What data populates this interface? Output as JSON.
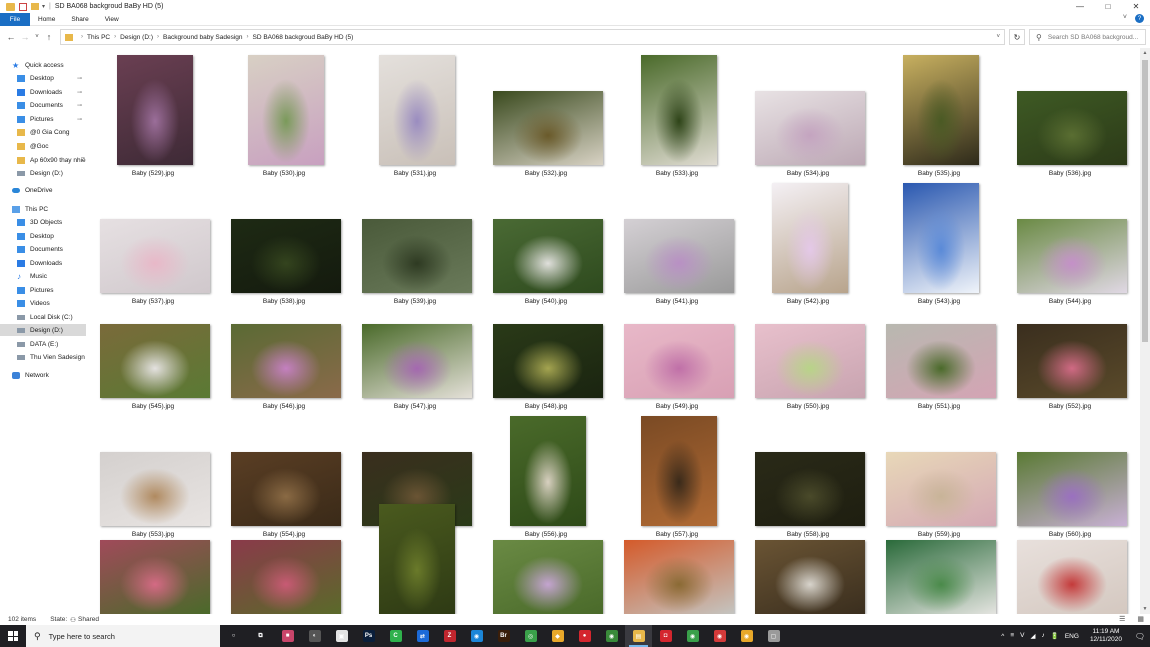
{
  "window": {
    "title": "SD BA068 backgroud BaBy HD (5)",
    "controls": {
      "minimize": "—",
      "maximize": "□",
      "close": "✕"
    }
  },
  "ribbon": {
    "tabs": [
      "File",
      "Home",
      "Share",
      "View"
    ],
    "expand": "˅",
    "help": "?"
  },
  "nav": {
    "back": "←",
    "forward": "→",
    "recent": "˅",
    "up": "↑",
    "breadcrumb": [
      "This PC",
      "Design (D:)",
      "Background baby Sadesign",
      "SD BA068 backgroud BaBy HD (5)"
    ],
    "dropdown": "˅",
    "refresh": "↻",
    "search_placeholder": "Search SD BA068 backgroud..."
  },
  "sidebar": {
    "items": [
      {
        "label": "Quick access",
        "icon": "star-icon",
        "indent": 0,
        "selected": false,
        "pinned": false
      },
      {
        "label": "Desktop",
        "icon": "desktop-icon",
        "indent": 1,
        "selected": false,
        "pinned": true
      },
      {
        "label": "Downloads",
        "icon": "download-icon",
        "indent": 1,
        "selected": false,
        "pinned": true
      },
      {
        "label": "Documents",
        "icon": "documents-icon",
        "indent": 1,
        "selected": false,
        "pinned": true
      },
      {
        "label": "Pictures",
        "icon": "pictures-icon",
        "indent": 1,
        "selected": false,
        "pinned": true
      },
      {
        "label": "@0 Gia Cong",
        "icon": "folder-icon",
        "indent": 1,
        "selected": false,
        "pinned": false
      },
      {
        "label": "@Goc",
        "icon": "folder-icon",
        "indent": 1,
        "selected": false,
        "pinned": false
      },
      {
        "label": "Ap 60x90 thay nhiề",
        "icon": "folder-icon",
        "indent": 1,
        "selected": false,
        "pinned": false
      },
      {
        "label": "Design (D:)",
        "icon": "drive-icon",
        "indent": 1,
        "selected": false,
        "pinned": false
      },
      {
        "label": "OneDrive",
        "icon": "cloud-icon",
        "indent": 0,
        "selected": false,
        "pinned": false
      },
      {
        "label": "This PC",
        "icon": "pc-icon",
        "indent": 0,
        "selected": false,
        "pinned": false
      },
      {
        "label": "3D Objects",
        "icon": "cube-icon",
        "indent": 1,
        "selected": false,
        "pinned": false
      },
      {
        "label": "Desktop",
        "icon": "desktop-icon",
        "indent": 1,
        "selected": false,
        "pinned": false
      },
      {
        "label": "Documents",
        "icon": "documents-icon",
        "indent": 1,
        "selected": false,
        "pinned": false
      },
      {
        "label": "Downloads",
        "icon": "download-icon",
        "indent": 1,
        "selected": false,
        "pinned": false
      },
      {
        "label": "Music",
        "icon": "music-icon",
        "indent": 1,
        "selected": false,
        "pinned": false
      },
      {
        "label": "Pictures",
        "icon": "pictures-icon",
        "indent": 1,
        "selected": false,
        "pinned": false
      },
      {
        "label": "Videos",
        "icon": "videos-icon",
        "indent": 1,
        "selected": false,
        "pinned": false
      },
      {
        "label": "Local Disk (C:)",
        "icon": "drive-icon",
        "indent": 1,
        "selected": false,
        "pinned": false
      },
      {
        "label": "Design (D:)",
        "icon": "drive-icon",
        "indent": 1,
        "selected": true,
        "pinned": false
      },
      {
        "label": "DATA  (E:)",
        "icon": "drive-icon",
        "indent": 1,
        "selected": false,
        "pinned": false
      },
      {
        "label": "Thu Vien Sadesign",
        "icon": "drive-icon",
        "indent": 1,
        "selected": false,
        "pinned": false
      },
      {
        "label": "Network",
        "icon": "network-icon",
        "indent": 0,
        "selected": false,
        "pinned": false
      }
    ],
    "pin_glyph": "📌"
  },
  "files": [
    {
      "name": "Baby (529).jpg",
      "orient": "portrait",
      "colors": [
        "#6a3f52",
        "#9b6e9a",
        "#3e2a36"
      ]
    },
    {
      "name": "Baby (530).jpg",
      "orient": "portrait",
      "colors": [
        "#d8d0c4",
        "#7a9a5a",
        "#c8a0c0"
      ]
    },
    {
      "name": "Baby (531).jpg",
      "orient": "portrait",
      "colors": [
        "#e4e0dc",
        "#9a8cc0",
        "#c9c0b8"
      ]
    },
    {
      "name": "Baby (532).jpg",
      "orient": "landscape",
      "colors": [
        "#3a4a1e",
        "#6a5a2a",
        "#d8d2c4"
      ]
    },
    {
      "name": "Baby (533).jpg",
      "orient": "portrait",
      "colors": [
        "#4a6a2a",
        "#2e4418",
        "#e0dcd2"
      ]
    },
    {
      "name": "Baby (534).jpg",
      "orient": "landscape",
      "colors": [
        "#e8e2e4",
        "#c4a4c0",
        "#bca8b4"
      ]
    },
    {
      "name": "Baby (535).jpg",
      "orient": "portrait",
      "colors": [
        "#c8b060",
        "#4a5a24",
        "#2e2a1a"
      ]
    },
    {
      "name": "Baby (536).jpg",
      "orient": "landscape",
      "colors": [
        "#3e5a24",
        "#5a6e32",
        "#2c3a18"
      ]
    },
    {
      "name": "Baby (537).jpg",
      "orient": "landscape",
      "colors": [
        "#e6e0e2",
        "#e8b8c8",
        "#d0c8cc"
      ]
    },
    {
      "name": "Baby (538).jpg",
      "orient": "landscape",
      "colors": [
        "#1e2a14",
        "#34441e",
        "#141a0e"
      ]
    },
    {
      "name": "Baby (539).jpg",
      "orient": "landscape",
      "colors": [
        "#4a5a3a",
        "#2e3a22",
        "#6a7a5a"
      ]
    },
    {
      "name": "Baby (540).jpg",
      "orient": "landscape",
      "colors": [
        "#4a6a34",
        "#e0e0dc",
        "#2e4a1e"
      ]
    },
    {
      "name": "Baby (541).jpg",
      "orient": "landscape",
      "colors": [
        "#d4d0d4",
        "#b890c4",
        "#9a9a9a"
      ]
    },
    {
      "name": "Baby (542).jpg",
      "orient": "portrait",
      "colors": [
        "#f4f0f4",
        "#e4c8e8",
        "#b8a48c"
      ]
    },
    {
      "name": "Baby (543).jpg",
      "orient": "portrait",
      "colors": [
        "#2a58b0",
        "#5a8ad8",
        "#f0f4fa"
      ]
    },
    {
      "name": "Baby (544).jpg",
      "orient": "landscape",
      "colors": [
        "#6a8a44",
        "#c490c8",
        "#e0d8e4"
      ]
    },
    {
      "name": "Baby (545).jpg",
      "orient": "landscape",
      "colors": [
        "#7a6a3a",
        "#e4e2e0",
        "#5a7a34"
      ]
    },
    {
      "name": "Baby (546).jpg",
      "orient": "landscape",
      "colors": [
        "#5a6a34",
        "#c480c0",
        "#8a6a4a"
      ]
    },
    {
      "name": "Baby (547).jpg",
      "orient": "landscape",
      "colors": [
        "#4a6a2a",
        "#a468b0",
        "#e4e0d8"
      ]
    },
    {
      "name": "Baby (548).jpg",
      "orient": "landscape",
      "colors": [
        "#2a3a18",
        "#a4a450",
        "#1a2410"
      ]
    },
    {
      "name": "Baby (549).jpg",
      "orient": "landscape",
      "colors": [
        "#e8b8c8",
        "#c070a8",
        "#d8a0b4"
      ]
    },
    {
      "name": "Baby (550).jpg",
      "orient": "landscape",
      "colors": [
        "#e8c0cc",
        "#b8d488",
        "#c8a4b0"
      ]
    },
    {
      "name": "Baby (551).jpg",
      "orient": "landscape",
      "colors": [
        "#b8b8b0",
        "#4a6a2a",
        "#d4a4b4"
      ]
    },
    {
      "name": "Baby (552).jpg",
      "orient": "landscape",
      "colors": [
        "#3a2e1e",
        "#d06a84",
        "#5a4a2a"
      ]
    },
    {
      "name": "Baby (553).jpg",
      "orient": "landscape",
      "colors": [
        "#d4d0ce",
        "#b08a60",
        "#e8e4e2"
      ]
    },
    {
      "name": "Baby (554).jpg",
      "orient": "landscape",
      "colors": [
        "#5a3e24",
        "#8a6a44",
        "#3a2a18"
      ]
    },
    {
      "name": "Baby (555).jpg",
      "orient": "landscape",
      "colors": [
        "#3a2e1e",
        "#6a5434",
        "#2a3a18"
      ]
    },
    {
      "name": "Baby (556).jpg",
      "orient": "portrait",
      "colors": [
        "#4a6a2a",
        "#d8d0c0",
        "#2e4a18"
      ]
    },
    {
      "name": "Baby (557).jpg",
      "orient": "portrait",
      "colors": [
        "#7a4a24",
        "#3a2a1a",
        "#b06a34"
      ]
    },
    {
      "name": "Baby (558).jpg",
      "orient": "landscape",
      "colors": [
        "#2a2a18",
        "#4a4a2a",
        "#1e1e10"
      ]
    },
    {
      "name": "Baby (559).jpg",
      "orient": "landscape",
      "colors": [
        "#e8d8b8",
        "#c8b498",
        "#d4a8b4"
      ]
    },
    {
      "name": "Baby (560).jpg",
      "orient": "landscape",
      "colors": [
        "#5a7a34",
        "#9a70c0",
        "#c8b0d4"
      ]
    },
    {
      "name": "",
      "orient": "landscape",
      "colors": [
        "#a04a5a",
        "#d46a84",
        "#4a6a2a"
      ]
    },
    {
      "name": "",
      "orient": "landscape",
      "colors": [
        "#8a3a4a",
        "#c85a74",
        "#5a6a2a"
      ]
    },
    {
      "name": "",
      "orient": "portrait",
      "colors": [
        "#4a5a1e",
        "#6a7a2a",
        "#2e3a14"
      ]
    },
    {
      "name": "",
      "orient": "landscape",
      "colors": [
        "#6a8a44",
        "#c4a4d0",
        "#4a6a2a"
      ]
    },
    {
      "name": "",
      "orient": "landscape",
      "colors": [
        "#d45a2a",
        "#8a6a34",
        "#c4c4c0"
      ]
    },
    {
      "name": "",
      "orient": "landscape",
      "colors": [
        "#6a5434",
        "#d8d4cc",
        "#3a2e1e"
      ]
    },
    {
      "name": "",
      "orient": "landscape",
      "colors": [
        "#2a6a3a",
        "#4a8a4a",
        "#e4e4e0"
      ]
    },
    {
      "name": "",
      "orient": "landscape",
      "colors": [
        "#e8e0dc",
        "#c43a3a",
        "#d4c8c0"
      ]
    }
  ],
  "status": {
    "items": "102 items",
    "state_label": "State:",
    "state_value": "Shared"
  },
  "taskbar": {
    "search_placeholder": "Type here to search",
    "apps": [
      {
        "name": "cortana-icon",
        "color": "#1f1f23",
        "glyph": "○"
      },
      {
        "name": "task-view-icon",
        "color": "#1f1f23",
        "glyph": "⧉"
      },
      {
        "name": "app-icon-1",
        "color": "#c8456a",
        "glyph": "■"
      },
      {
        "name": "app-icon-2",
        "color": "#555",
        "glyph": "◐"
      },
      {
        "name": "app-icon-3",
        "color": "#e4e4e4",
        "glyph": "▣"
      },
      {
        "name": "photoshop-icon",
        "color": "#0a1e3a",
        "glyph": "Ps"
      },
      {
        "name": "app-icon-4",
        "color": "#2fb14c",
        "glyph": "C"
      },
      {
        "name": "teamviewer-icon",
        "color": "#1c6ad8",
        "glyph": "⇄"
      },
      {
        "name": "filezilla-icon",
        "color": "#c0262e",
        "glyph": "Z"
      },
      {
        "name": "app-icon-5",
        "color": "#1c86d8",
        "glyph": "◉"
      },
      {
        "name": "bridge-icon",
        "color": "#3a1e0a",
        "glyph": "Br"
      },
      {
        "name": "app-icon-6",
        "color": "#3aa04a",
        "glyph": "◎"
      },
      {
        "name": "app-icon-7",
        "color": "#e8a82a",
        "glyph": "◆"
      },
      {
        "name": "app-icon-8",
        "color": "#d4262e",
        "glyph": "●"
      },
      {
        "name": "chrome-icon",
        "color": "#3a8a3a",
        "glyph": "◉"
      },
      {
        "name": "file-explorer-icon",
        "color": "#e8b84a",
        "glyph": "▤"
      },
      {
        "name": "app-icon-9",
        "color": "#d4262e",
        "glyph": "◘"
      },
      {
        "name": "chrome-icon-2",
        "color": "#3aa04a",
        "glyph": "◉"
      },
      {
        "name": "chrome-icon-3",
        "color": "#d43a3a",
        "glyph": "◉"
      },
      {
        "name": "chrome-icon-4",
        "color": "#e8a82a",
        "glyph": "◉"
      },
      {
        "name": "app-icon-10",
        "color": "#9a9a9a",
        "glyph": "▢"
      }
    ],
    "active_app": "file-explorer-icon",
    "tray": {
      "chevron": "^",
      "icons": [
        "≡",
        "V",
        "◢",
        "♪",
        "🔋"
      ],
      "lang": "ENG",
      "time": "11:19 AM",
      "date": "12/11/2020",
      "notification": "🗨"
    }
  }
}
